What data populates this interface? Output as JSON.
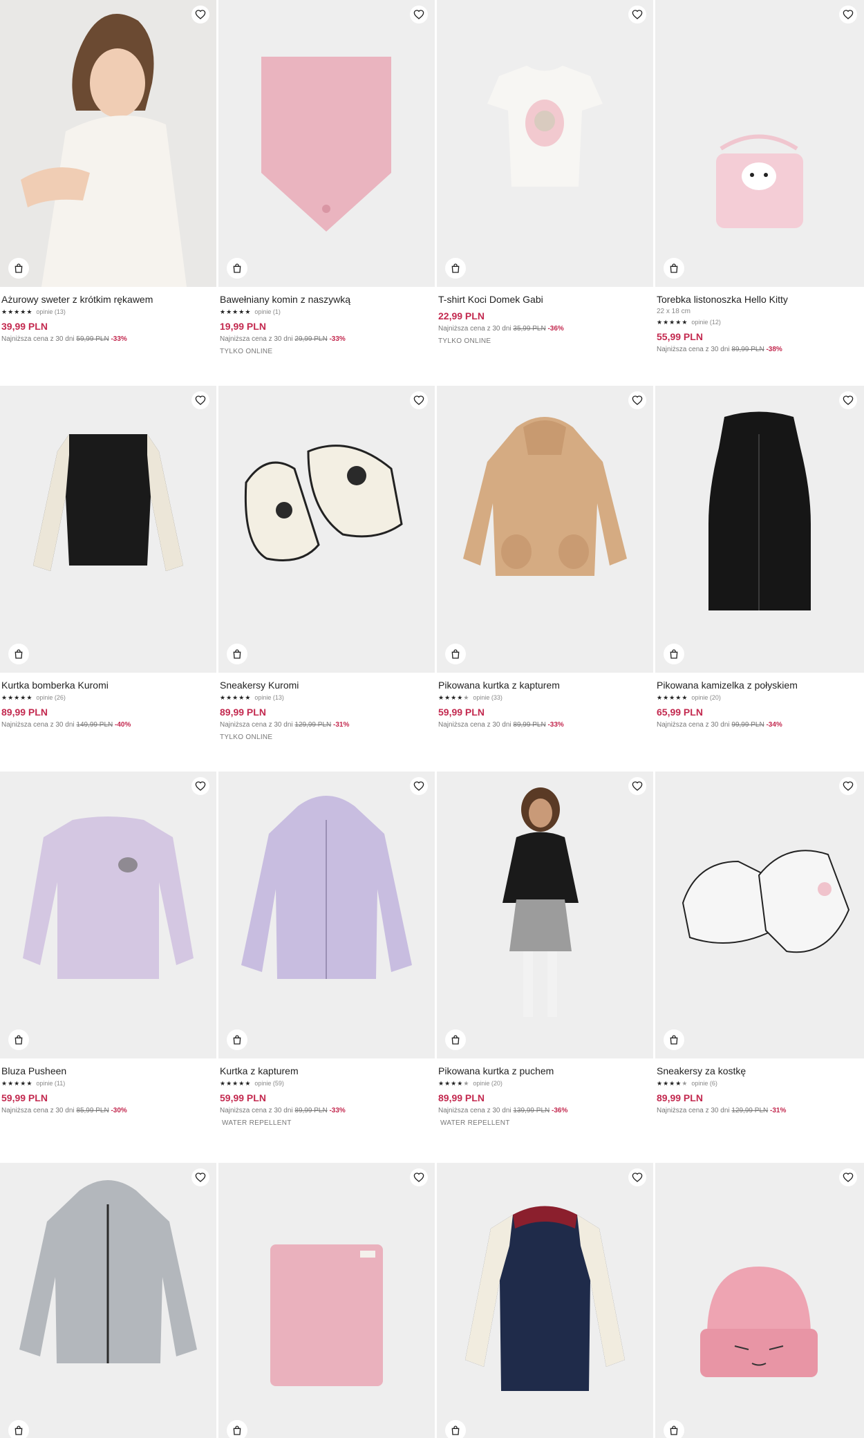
{
  "products": [
    {
      "name": "Ażurowy sweter z krótkim rękawem",
      "reviews": "opinie (13)",
      "stars": 5,
      "price": "39,99 PLN",
      "lowest_label": "Najniższa cena z 30 dni",
      "old_price": "59,99 PLN",
      "discount": "-33%"
    },
    {
      "name": "Bawełniany komin z naszywką",
      "reviews": "opinie (1)",
      "stars": 5,
      "price": "19,99 PLN",
      "lowest_label": "Najniższa cena z 30 dni",
      "old_price": "29,99 PLN",
      "discount": "-33%",
      "tag": "TYLKO ONLINE"
    },
    {
      "name": "T-shirt Koci Domek Gabi",
      "price": "22,99 PLN",
      "lowest_label": "Najniższa cena z 30 dni",
      "old_price": "35,99 PLN",
      "discount": "-36%",
      "tag": "TYLKO ONLINE"
    },
    {
      "name": "Torebka listonoszka Hello Kitty",
      "size": "22 x 18 cm",
      "reviews": "opinie (12)",
      "stars": 5,
      "price": "55,99 PLN",
      "lowest_label": "Najniższa cena z 30 dni",
      "old_price": "89,99 PLN",
      "discount": "-38%"
    },
    {
      "name": "Kurtka bomberka Kuromi",
      "reviews": "opinie (26)",
      "stars": 5,
      "price": "89,99 PLN",
      "lowest_label": "Najniższa cena z 30 dni",
      "old_price": "149,99 PLN",
      "discount": "-40%"
    },
    {
      "name": "Sneakersy Kuromi",
      "reviews": "opinie (13)",
      "stars": 5,
      "price": "89,99 PLN",
      "lowest_label": "Najniższa cena z 30 dni",
      "old_price": "129,99 PLN",
      "discount": "-31%",
      "tag": "TYLKO ONLINE"
    },
    {
      "name": "Pikowana kurtka z kapturem",
      "reviews": "opinie (33)",
      "stars": 4.5,
      "price": "59,99 PLN",
      "lowest_label": "Najniższa cena z 30 dni",
      "old_price": "89,99 PLN",
      "discount": "-33%"
    },
    {
      "name": "Pikowana kamizelka z połyskiem",
      "reviews": "opinie (20)",
      "stars": 5,
      "price": "65,99 PLN",
      "lowest_label": "Najniższa cena z 30 dni",
      "old_price": "99,99 PLN",
      "discount": "-34%"
    },
    {
      "name": "Bluza Pusheen",
      "reviews": "opinie (11)",
      "stars": 5,
      "price": "59,99 PLN",
      "lowest_label": "Najniższa cena z 30 dni",
      "old_price": "85,99 PLN",
      "discount": "-30%"
    },
    {
      "name": "Kurtka z kapturem",
      "reviews": "opinie (59)",
      "stars": 5,
      "price": "59,99 PLN",
      "lowest_label": "Najniższa cena z 30 dni",
      "old_price": "89,99 PLN",
      "discount": "-33%",
      "tag": "WATER REPELLENT"
    },
    {
      "name": "Pikowana kurtka z puchem",
      "reviews": "opinie (20)",
      "stars": 4.5,
      "price": "89,99 PLN",
      "lowest_label": "Najniższa cena z 30 dni",
      "old_price": "139,99 PLN",
      "discount": "-36%",
      "tag": "WATER REPELLENT"
    },
    {
      "name": "Sneakersy za kostkę",
      "reviews": "opinie (6)",
      "stars": 4.5,
      "price": "89,99 PLN",
      "lowest_label": "Najniższa cena z 30 dni",
      "old_price": "129,99 PLN",
      "discount": "-31%"
    },
    {
      "name": "",
      "price": ""
    },
    {
      "name": "",
      "price": ""
    },
    {
      "name": "",
      "price": ""
    },
    {
      "name": "",
      "price": ""
    }
  ],
  "icons": {
    "favorite": "heart-icon",
    "add_to_cart": "shopping-bag-icon",
    "rating": "star-icon"
  },
  "colors": {
    "price": "#c3294f",
    "discount": "#c3294f",
    "image_bg": "#eeeeee"
  }
}
